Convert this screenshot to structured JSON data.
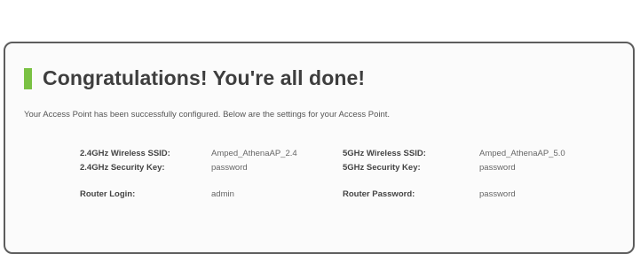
{
  "header": {
    "title": "Congratulations! You're all done!",
    "accent_color": "#7ac143"
  },
  "intro_text": "Your Access Point has been successfully configured. Below are the settings for your Access Point.",
  "settings": {
    "ssid_24_label": "2.4GHz Wireless SSID:",
    "ssid_24_value": "Amped_AthenaAP_2.4",
    "ssid_5_label": "5GHz Wireless SSID:",
    "ssid_5_value": "Amped_AthenaAP_5.0",
    "key_24_label": "2.4GHz Security Key:",
    "key_24_value": "password",
    "key_5_label": "5GHz Security Key:",
    "key_5_value": "password",
    "router_login_label": "Router Login:",
    "router_login_value": "admin",
    "router_password_label": "Router Password:",
    "router_password_value": "password"
  }
}
